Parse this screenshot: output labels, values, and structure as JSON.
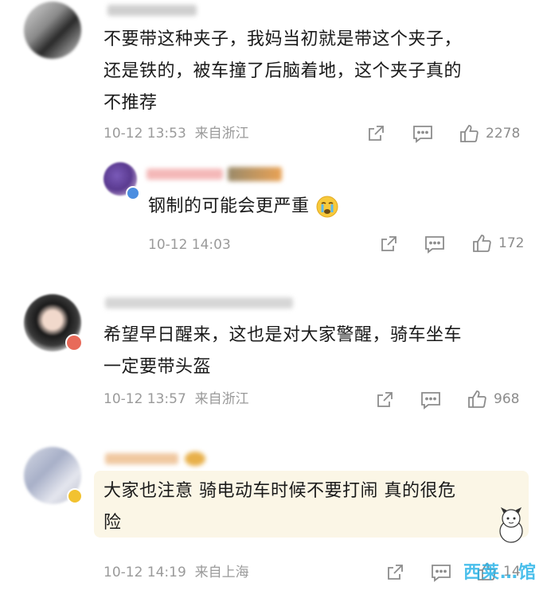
{
  "comments": [
    {
      "text_lines": [
        "不要带这种夹子，我妈当初就是带这个夹子，",
        "还是铁的，被车撞了后脑着地，这个夹子真的",
        "不推荐"
      ],
      "time": "10-12 13:53",
      "location": "来自浙江",
      "likes": "2278",
      "reply": {
        "text": "钢制的可能会更严重",
        "emoji": "crying-face-icon",
        "time": "10-12 14:03",
        "likes": "172"
      }
    },
    {
      "text_lines": [
        "希望早日醒来，这也是对大家警醒，骑车坐车",
        "一定要带头盔"
      ],
      "time": "10-12 13:57",
      "location": "来自浙江",
      "likes": "968"
    },
    {
      "text_lines": [
        "大家也注意 骑电动车时候不要打闹 真的很危",
        "险"
      ],
      "time": "10-12 14:19",
      "location": "来自上海",
      "likes": "14"
    }
  ],
  "watermark": "西莱…馆",
  "colors": {
    "meta": "#9a9a9a",
    "icon": "#8c8c8c",
    "highlight_bg": "#fbf6e6"
  }
}
